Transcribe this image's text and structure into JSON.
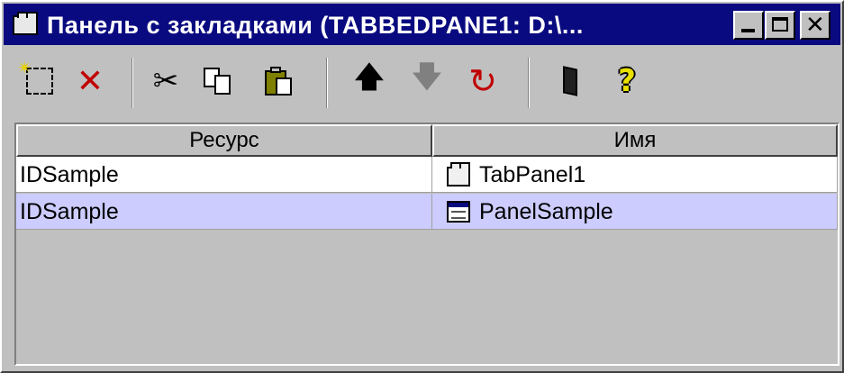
{
  "window": {
    "title": "Панель с закладками (TABBEDPANE1: D:\\..."
  },
  "title_buttons": {
    "minimize": "minimize-icon",
    "maximize": "maximize-icon",
    "close": "close-icon"
  },
  "toolbar": {
    "icons": [
      "new-icon",
      "delete-icon",
      "cut-icon",
      "copy-icon",
      "paste-icon",
      "move-up-icon",
      "move-down-icon",
      "refresh-icon",
      "exit-icon",
      "help-icon"
    ],
    "cut_glyph": "✂",
    "delete_glyph": "✕",
    "up_glyph": "🡅",
    "down_glyph": "🡇",
    "refresh_glyph": "↻",
    "help_glyph": "?"
  },
  "table": {
    "columns": [
      "Ресурс",
      "Имя"
    ],
    "rows": [
      {
        "resource": "IDSample",
        "name": "TabPanel1",
        "icon": "tabbed-pane-icon"
      },
      {
        "resource": "IDSample",
        "name": "PanelSample",
        "icon": "panel-icon"
      }
    ],
    "selected_row_color": "#ccccff"
  },
  "colors": {
    "titlebar": "#0a0a80",
    "face": "#c0c0c0",
    "delete": "#c00000",
    "help": "#e8e000"
  }
}
